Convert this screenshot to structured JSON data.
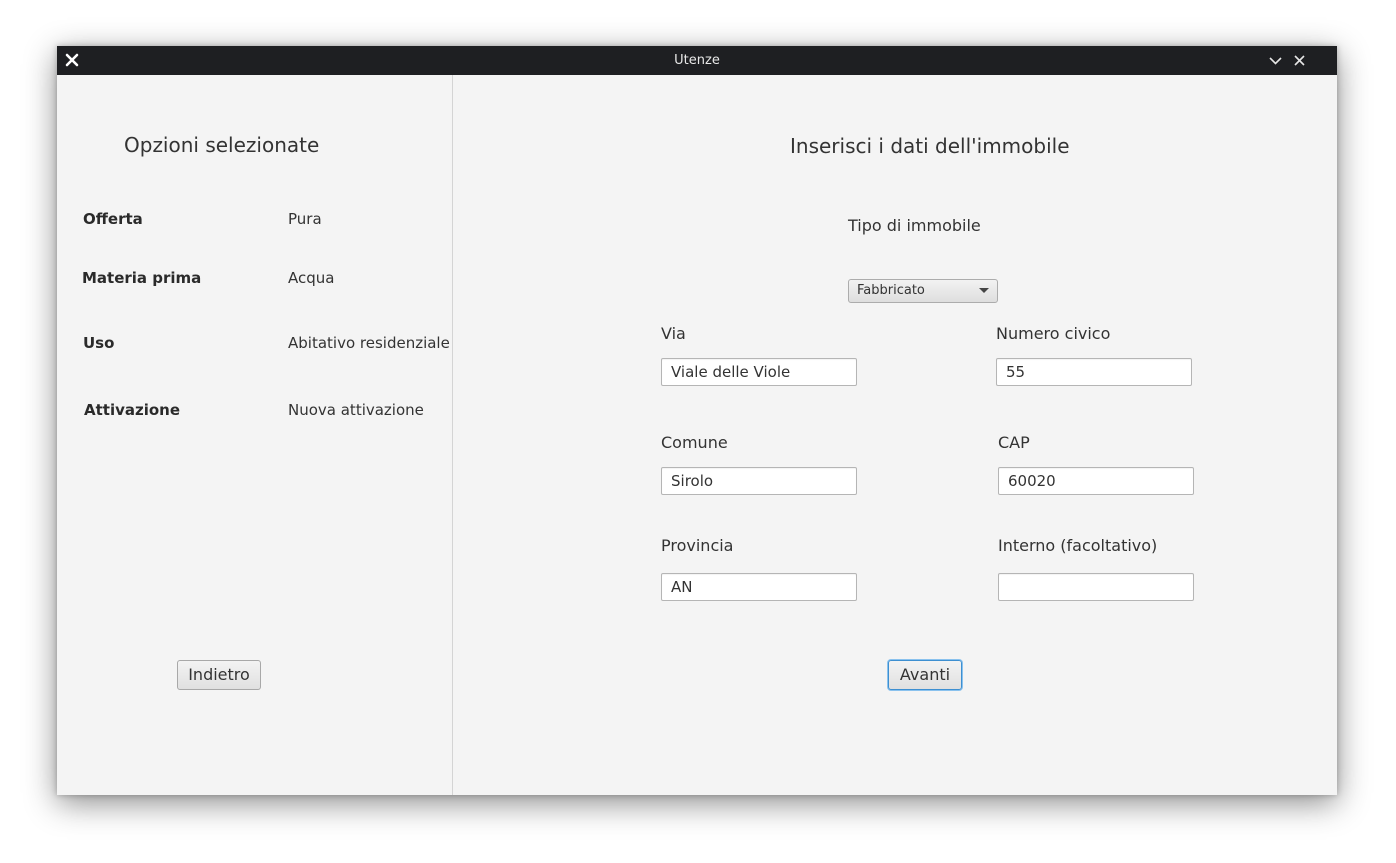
{
  "window": {
    "title": "Utenze"
  },
  "left": {
    "heading": "Opzioni selezionate",
    "rows": [
      {
        "label": "Offerta",
        "value": "Pura"
      },
      {
        "label": "Materia prima",
        "value": "Acqua"
      },
      {
        "label": "Uso",
        "value": "Abitativo residenziale"
      },
      {
        "label": "Attivazione",
        "value": "Nuova attivazione"
      }
    ],
    "back_button": "Indietro"
  },
  "form": {
    "heading": "Inserisci i dati dell'immobile",
    "property_type_label": "Tipo di immobile",
    "property_type_selected": "Fabbricato",
    "via_label": "Via",
    "via_value": "Viale delle Viole",
    "civico_label": "Numero civico",
    "civico_value": "55",
    "comune_label": "Comune",
    "comune_value": "Sirolo",
    "cap_label": "CAP",
    "cap_value": "60020",
    "provincia_label": "Provincia",
    "provincia_value": "AN",
    "interno_label": "Interno (facoltativo)",
    "interno_value": "",
    "next_button": "Avanti"
  },
  "icons": {
    "app": "close-x-app-icon",
    "minimize": "chevron-down-icon",
    "close": "close-icon"
  }
}
